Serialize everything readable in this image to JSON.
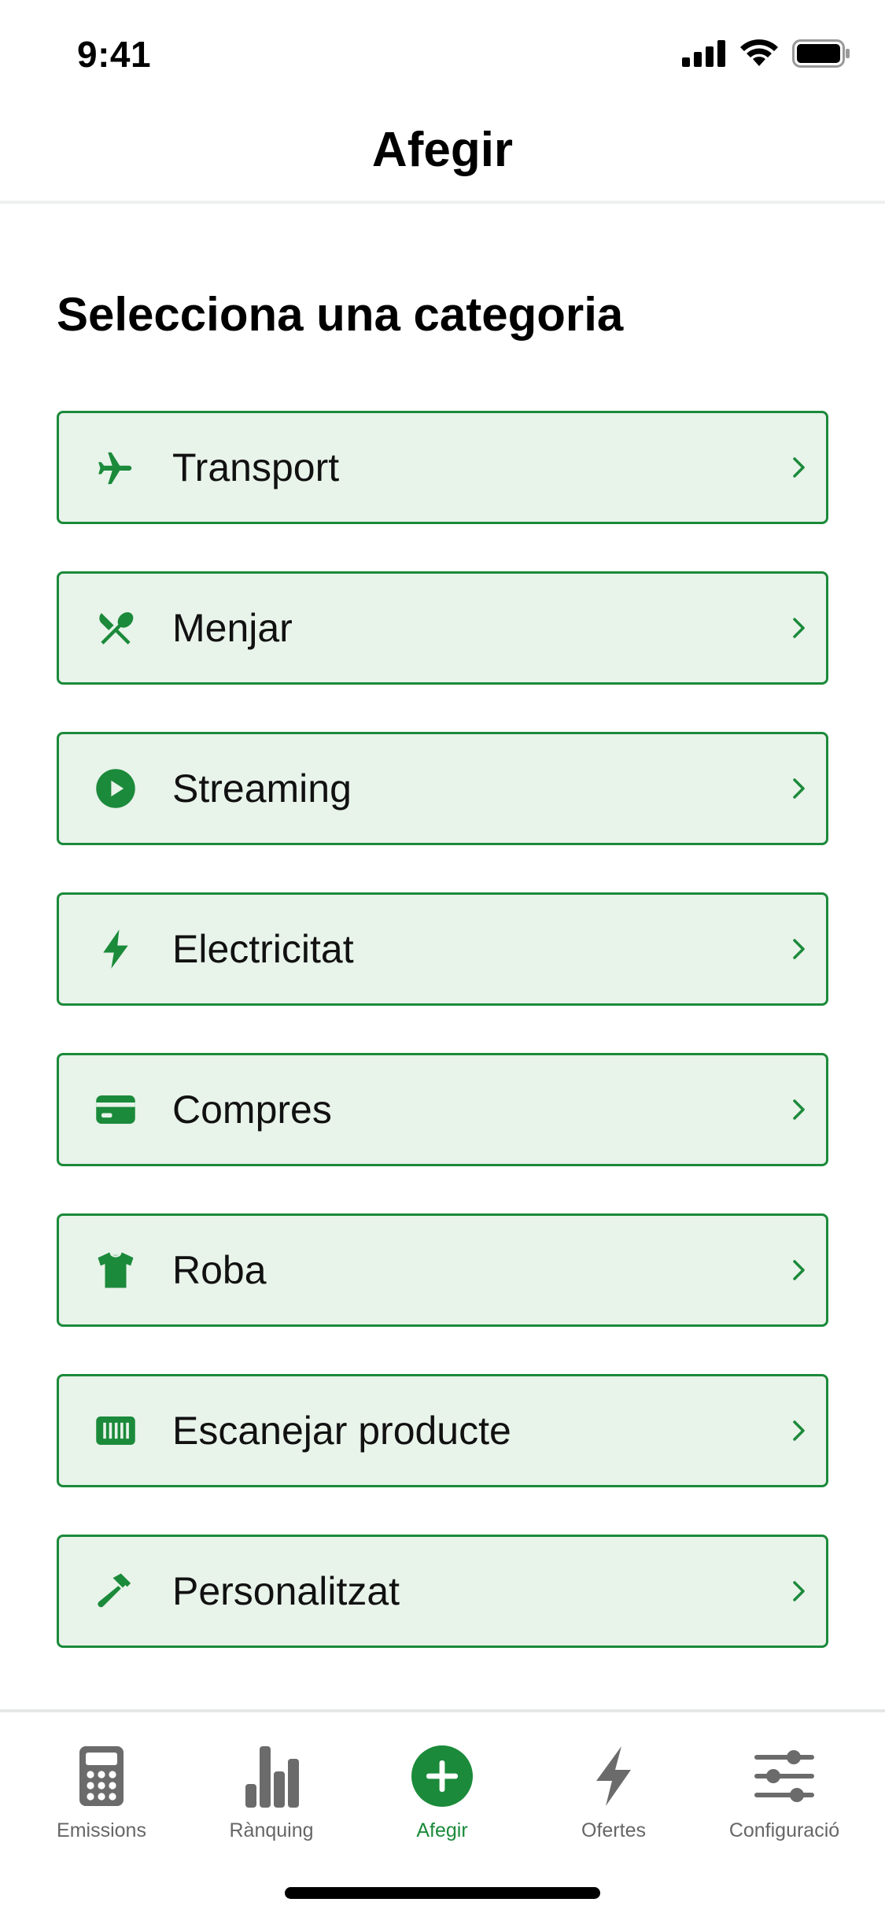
{
  "status_bar": {
    "time": "9:41"
  },
  "header": {
    "title": "Afegir"
  },
  "main": {
    "section_title": "Selecciona una categoria",
    "categories": [
      {
        "label": "Transport",
        "icon": "airplane-icon"
      },
      {
        "label": "Menjar",
        "icon": "utensils-icon"
      },
      {
        "label": "Streaming",
        "icon": "play-circle-icon"
      },
      {
        "label": "Electricitat",
        "icon": "bolt-icon"
      },
      {
        "label": "Compres",
        "icon": "credit-card-icon"
      },
      {
        "label": "Roba",
        "icon": "tshirt-icon"
      },
      {
        "label": "Escanejar producte",
        "icon": "barcode-icon"
      },
      {
        "label": "Personalitzat",
        "icon": "hammer-icon"
      }
    ]
  },
  "tab_bar": {
    "tabs": [
      {
        "label": "Emissions",
        "icon": "calculator-icon",
        "active": false
      },
      {
        "label": "Rànquing",
        "icon": "bar-chart-icon",
        "active": false
      },
      {
        "label": "Afegir",
        "icon": "plus-circle-icon",
        "active": true
      },
      {
        "label": "Ofertes",
        "icon": "bolt-icon",
        "active": false
      },
      {
        "label": "Configuració",
        "icon": "sliders-icon",
        "active": false
      }
    ]
  },
  "colors": {
    "accent": "#1b8a3a",
    "item_background": "#e8f3ea",
    "inactive_tab": "#666666"
  }
}
